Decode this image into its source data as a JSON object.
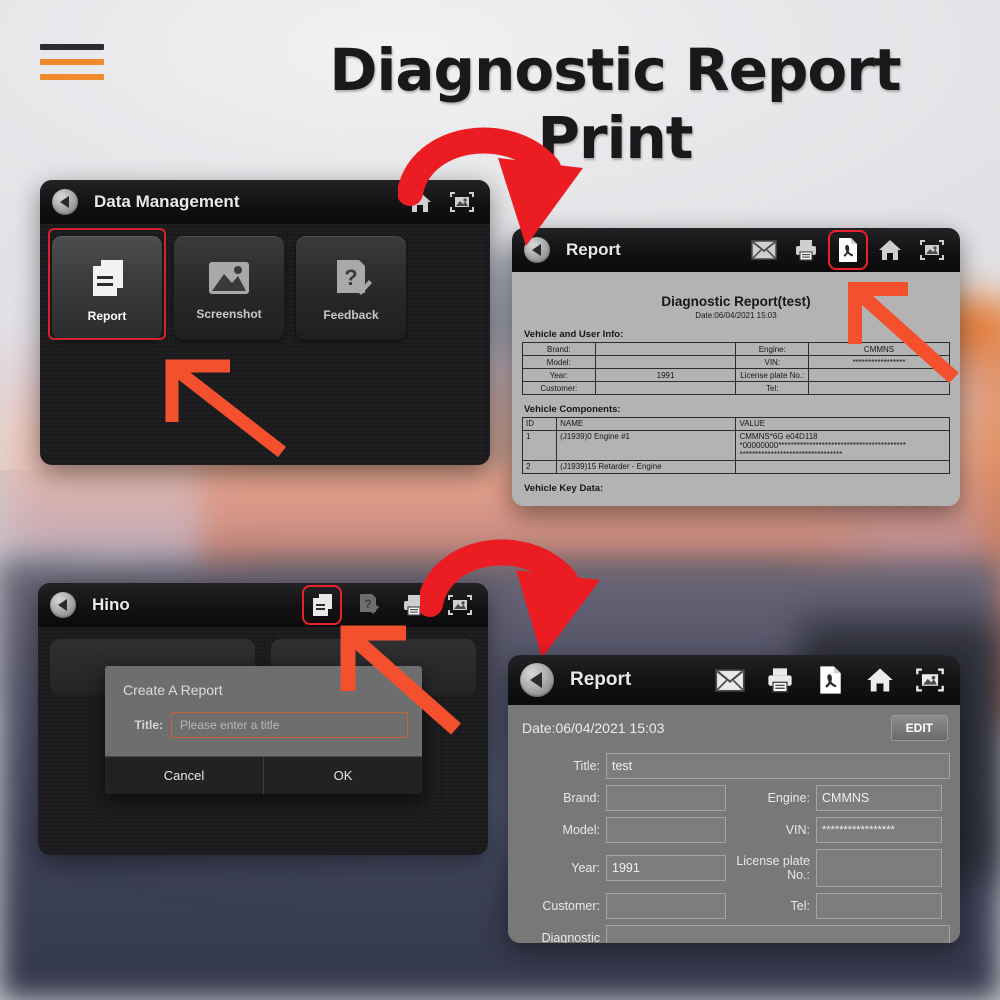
{
  "header": {
    "title": "Diagnostic Report Print",
    "menu_icon": "hamburger-icon"
  },
  "panel_data_management": {
    "title": "Data Management",
    "back_icon": "back-arrow-icon",
    "titlebar_icons": [
      "home-icon",
      "screenshot-icon"
    ],
    "tiles": [
      {
        "label": "Report",
        "icon": "report-document-icon",
        "selected": true
      },
      {
        "label": "Screenshot",
        "icon": "image-icon",
        "selected": false
      },
      {
        "label": "Feedback",
        "icon": "feedback-question-icon",
        "selected": false
      }
    ]
  },
  "panel_report_preview": {
    "title": "Report",
    "back_icon": "back-arrow-icon",
    "titlebar_icons": [
      "mail-icon",
      "print-icon",
      "pdf-icon",
      "home-icon",
      "screenshot-icon"
    ],
    "highlighted_icon": "pdf-icon",
    "doc_title": "Diagnostic Report(test)",
    "doc_date": "Date:06/04/2021 15:03",
    "section_vehicle_user": "Vehicle and User Info:",
    "vehicle_user_rows": [
      {
        "l1": "Brand:",
        "v1": "",
        "l2": "Engine:",
        "v2": "CMMNS"
      },
      {
        "l1": "Model:",
        "v1": "",
        "l2": "VIN:",
        "v2": "*****************"
      },
      {
        "l1": "Year:",
        "v1": "1991",
        "l2": "License plate No.:",
        "v2": ""
      },
      {
        "l1": "Customer:",
        "v1": "",
        "l2": "Tel:",
        "v2": ""
      }
    ],
    "section_components": "Vehicle Components:",
    "components_headers": [
      "ID",
      "NAME",
      "VALUE"
    ],
    "components_rows": [
      {
        "id": "1",
        "name": "(J1939)0 Engine #1",
        "value_line1": "CMMNS*6G e04D118",
        "value_line2": "*00000000*****************************************",
        "value_line3": "*********************************"
      },
      {
        "id": "2",
        "name": "(J1939)15 Retarder - Engine",
        "value_line1": "",
        "value_line2": "",
        "value_line3": ""
      }
    ],
    "section_key_data": "Vehicle Key Data:"
  },
  "panel_hino": {
    "title": "Hino",
    "back_icon": "back-arrow-icon",
    "titlebar_icons": [
      "report-document-icon",
      "feedback-question-icon",
      "print-icon",
      "screenshot-icon"
    ],
    "highlighted_icon": "report-document-icon",
    "dialog": {
      "title": "Create A Report",
      "field_label": "Title:",
      "field_value": "",
      "field_placeholder": "Please enter a title",
      "cancel_label": "Cancel",
      "ok_label": "OK"
    }
  },
  "panel_report_form": {
    "title": "Report",
    "back_icon": "back-arrow-icon",
    "titlebar_icons": [
      "mail-icon",
      "print-icon",
      "pdf-icon",
      "home-icon",
      "screenshot-icon"
    ],
    "date_label": "Date:06/04/2021 15:03",
    "edit_label": "EDIT",
    "fields": {
      "title_label": "Title:",
      "title_value": "test",
      "brand_label": "Brand:",
      "brand_value": "",
      "engine_label": "Engine:",
      "engine_value": "CMMNS",
      "model_label": "Model:",
      "model_value": "",
      "vin_label": "VIN:",
      "vin_value": "*****************",
      "year_label": "Year:",
      "year_value": "1991",
      "plate_label": "License plate No.:",
      "plate_value": "",
      "customer_label": "Customer:",
      "customer_value": "",
      "tel_label": "Tel:",
      "tel_value": "",
      "diagnostic_label": "Diagnostic",
      "diagnostic_value": ""
    }
  },
  "annotations": {
    "arrow_color": "#f44336",
    "straight_arrow_color": "#f4502e",
    "highlight_color": "#d62230"
  }
}
